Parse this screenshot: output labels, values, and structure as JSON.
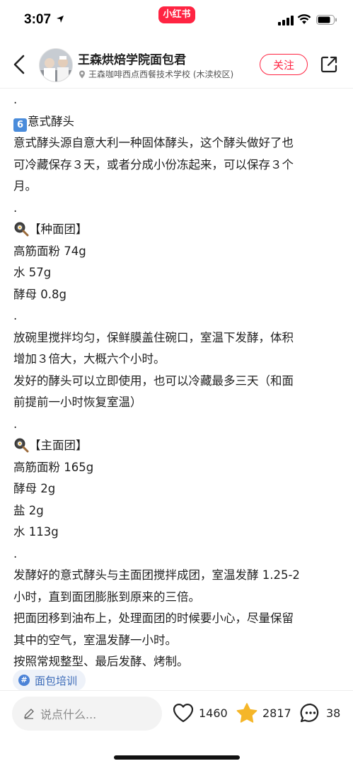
{
  "status_bar": {
    "time": "3:07",
    "app_badge": "小红书"
  },
  "header": {
    "author": "王森烘焙学院面包君",
    "location": "王森咖啡西点西餐技术学校 (木渎校区)",
    "follow_label": "关注"
  },
  "note": {
    "lines": [
      {
        "text": "."
      },
      {
        "prefix": "num",
        "num": "6",
        "text": "意式酵头"
      },
      {
        "text": "意式酵头源自意大利一种固体酵头，这个酵头做好了也"
      },
      {
        "text": "可冷藏保存３天，或者分成小份冻起来，可以保存３个"
      },
      {
        "text": "月。"
      },
      {
        "text": "."
      },
      {
        "prefix": "pan",
        "text": "【种面团】"
      },
      {
        "text": "高筋面粉 74g"
      },
      {
        "text": "水 57g"
      },
      {
        "text": "酵母 0.8g"
      },
      {
        "text": "."
      },
      {
        "text": "放碗里搅拌均匀，保鲜膜盖住碗口，室温下发酵，体积"
      },
      {
        "text": "增加３倍大，大概六个小时。"
      },
      {
        "text": "发好的酵头可以立即使用，也可以冷藏最多三天（和面"
      },
      {
        "text": "前提前一小时恢复室温）"
      },
      {
        "text": "."
      },
      {
        "prefix": "pan",
        "text": "【主面团】"
      },
      {
        "text": "高筋面粉 165g"
      },
      {
        "text": "酵母 2g"
      },
      {
        "text": "盐 2g"
      },
      {
        "text": "水 113g"
      },
      {
        "text": "."
      },
      {
        "text": "发酵好的意式酵头与主面团搅拌成团，室温发酵 1.25-2"
      },
      {
        "text": "小时，直到面团膨胀到原来的三倍。"
      },
      {
        "text": "把面团移到油布上，处理面团的时候要小心，尽量保留"
      },
      {
        "text": "其中的空气，室温发酵一小时。"
      },
      {
        "text": "按照常规整型、最后发酵、烤制。"
      }
    ],
    "tag": "面包培训"
  },
  "bottom_bar": {
    "comment_placeholder": "说点什么...",
    "likes": "1460",
    "collects": "2817",
    "comments": "38"
  },
  "colors": {
    "accent": "#ff2442",
    "tag_text": "#3c6bb8",
    "star": "#f5b629"
  },
  "icons": [
    "location-arrow-icon",
    "signal-icon",
    "wifi-icon",
    "battery-icon",
    "back-icon",
    "pin-icon",
    "share-icon",
    "frying-pan-icon",
    "hashtag-icon",
    "pencil-icon",
    "heart-icon",
    "star-icon",
    "comment-icon"
  ]
}
